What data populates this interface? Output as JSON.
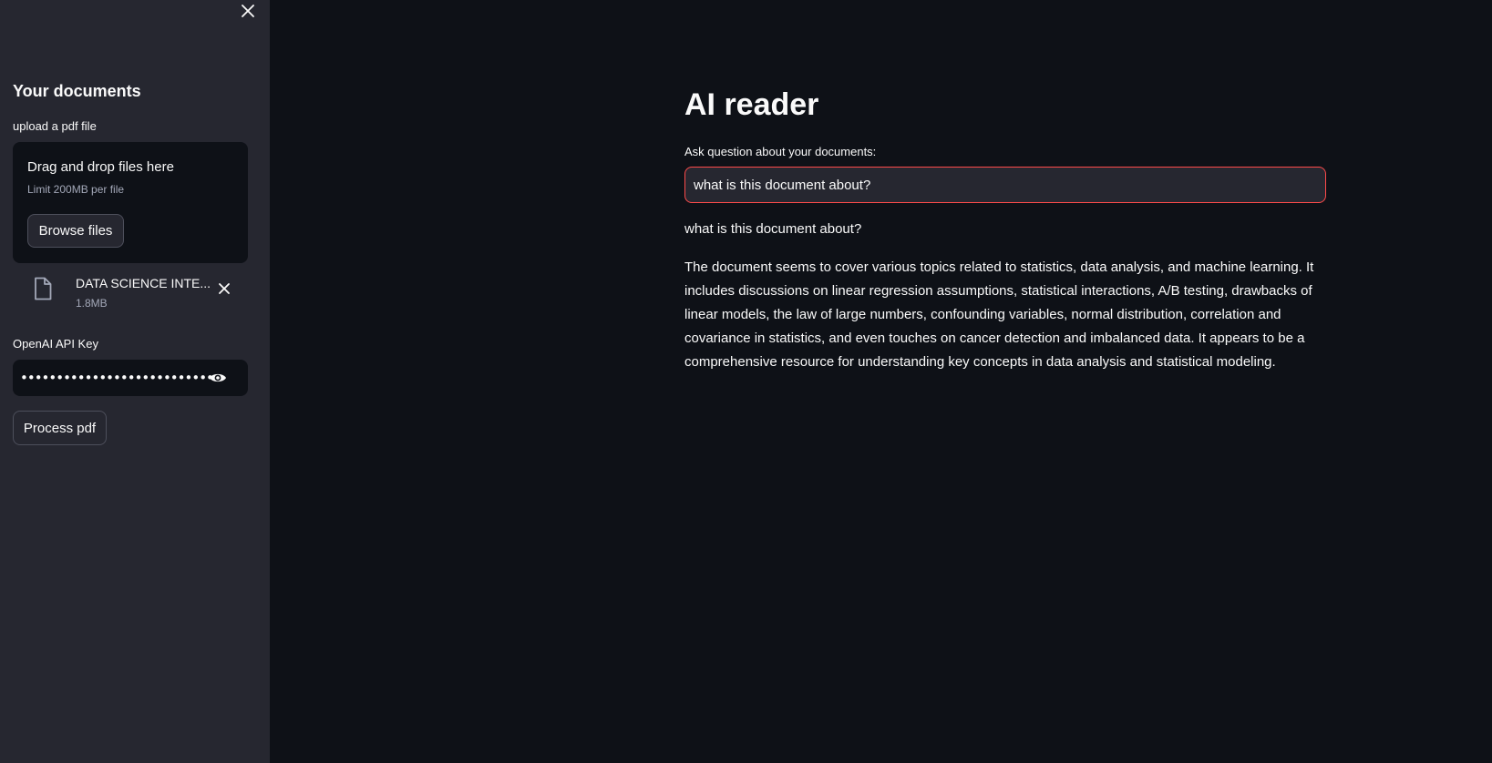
{
  "sidebar": {
    "heading": "Your documents",
    "upload_label": "upload a pdf file",
    "dropzone": {
      "title": "Drag and drop files here",
      "limit": "Limit 200MB per file",
      "browse_label": "Browse files"
    },
    "file": {
      "name": "DATA SCIENCE INTE...",
      "size": "1.8MB",
      "icon": "file-icon"
    },
    "api_key": {
      "label": "OpenAI API Key",
      "value": "•••••••••••••••••••••••••••••••••••••••••••••"
    },
    "process_label": "Process pdf"
  },
  "main": {
    "title": "AI reader",
    "question_label": "Ask question about your documents:",
    "question_value": "what is this document about?",
    "echo_question": "what is this document about?",
    "answer": "The document seems to cover various topics related to statistics, data analysis, and machine learning. It includes discussions on linear regression assumptions, statistical interactions, A/B testing, drawbacks of linear models, the law of large numbers, confounding variables, normal distribution, correlation and covariance in statistics, and even touches on cancer detection and imbalanced data. It appears to be a comprehensive resource for understanding key concepts in data analysis and statistical modeling."
  },
  "colors": {
    "background": "#0e1117",
    "sidebar": "#262730",
    "accent": "#ff4b4b",
    "text": "#fafafa",
    "muted": "#a3a8b8"
  }
}
